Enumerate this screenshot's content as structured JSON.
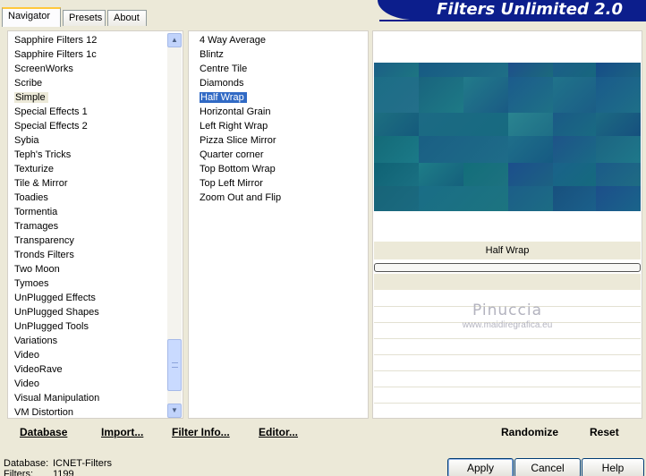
{
  "tabs": [
    "Navigator",
    "Presets",
    "About"
  ],
  "banner_title": "Filters Unlimited 2.0",
  "categories": [
    "Sapphire Filters 12",
    "Sapphire Filters 1c",
    "ScreenWorks",
    "Scribe",
    "Simple",
    "Special Effects 1",
    "Special Effects 2",
    "Sybia",
    "Teph's Tricks",
    "Texturize",
    "Tile & Mirror",
    "Toadies",
    "Tormentia",
    "Tramages",
    "Transparency",
    "Tronds Filters",
    "Two Moon",
    "Tymoes",
    "UnPlugged Effects",
    "UnPlugged Shapes",
    "UnPlugged Tools",
    "Variations",
    "Video",
    "VideoRave",
    "Video",
    "Visual Manipulation",
    "VM Distortion"
  ],
  "selected_category": "Simple",
  "filters": [
    "4 Way Average",
    "Blintz",
    "Centre Tile",
    "Diamonds",
    "Half Wrap",
    "Horizontal Grain",
    "Left Right Wrap",
    "Pizza Slice Mirror",
    "Quarter corner",
    "Top Bottom Wrap",
    "Top Left Mirror",
    "Zoom Out and Flip"
  ],
  "selected_filter": "Half Wrap",
  "preview_filter_name": "Half Wrap",
  "watermark": {
    "title": "Pinuccia",
    "url": "www.maidiregrafica.eu"
  },
  "actions_left": [
    "Database",
    "Import...",
    "Filter Info...",
    "Editor..."
  ],
  "actions_right": [
    "Randomize",
    "Reset"
  ],
  "status": {
    "database_label": "Database:",
    "database_value": "ICNET-Filters",
    "filters_label": "Filters:",
    "filters_value": "1199"
  },
  "dialog_buttons": [
    "Apply",
    "Cancel",
    "Help"
  ],
  "colors": {
    "banner": "#0c1e8c",
    "selection": "#316ac5",
    "panel": "#ece9d8"
  },
  "icons": {
    "scroll_up": "chevron-up-icon",
    "scroll_down": "chevron-down-icon"
  }
}
